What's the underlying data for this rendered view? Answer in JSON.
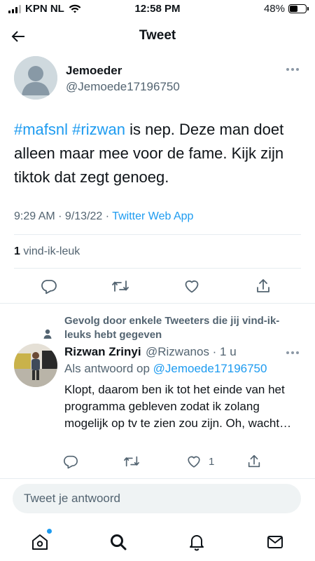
{
  "status_bar": {
    "carrier": "KPN NL",
    "time": "12:58 PM",
    "battery": "48%",
    "battery_level": 0.48
  },
  "header": {
    "title": "Tweet"
  },
  "tweet": {
    "author_name": "Jemoeder",
    "author_handle": "@Jemoede17196750",
    "text_hashtag_1": "#mafsnl",
    "text_hashtag_2": "#rizwan",
    "text_body": " is nep. Deze man doet alleen maar mee voor de fame. Kijk zijn tiktok dat zegt genoeg.",
    "timestamp": "9:29 AM · 9/13/22 · ",
    "source": "Twitter Web App",
    "like_count": "1",
    "like_label": " vind-ik-leuk"
  },
  "reply": {
    "social_context": "Gevolg door enkele Tweeters die jij vind-ik-leuks hebt gegeven",
    "author_name": "Rizwan Zrinyi",
    "author_handle": "@Rizwanos · 1 u",
    "reply_to_prefix": "Als antwoord op ",
    "reply_to_mention": "@Jemoede17196750",
    "text": "Klopt, daarom ben ik tot het einde van het programma gebleven zodat ik zolang mogelijk op tv te zien zou zijn. Oh, wacht…",
    "like_count": "1"
  },
  "compose": {
    "placeholder": "Tweet je antwoord"
  },
  "colors": {
    "accent": "#1d9bf0",
    "secondary_text": "#536471"
  },
  "icons": {
    "back": "arrow-left-icon",
    "reply": "comment-icon",
    "retweet": "retweet-icon",
    "like": "heart-icon",
    "share": "share-icon",
    "home": "home-icon",
    "search": "search-icon",
    "notifications": "bell-icon",
    "messages": "mail-icon"
  }
}
